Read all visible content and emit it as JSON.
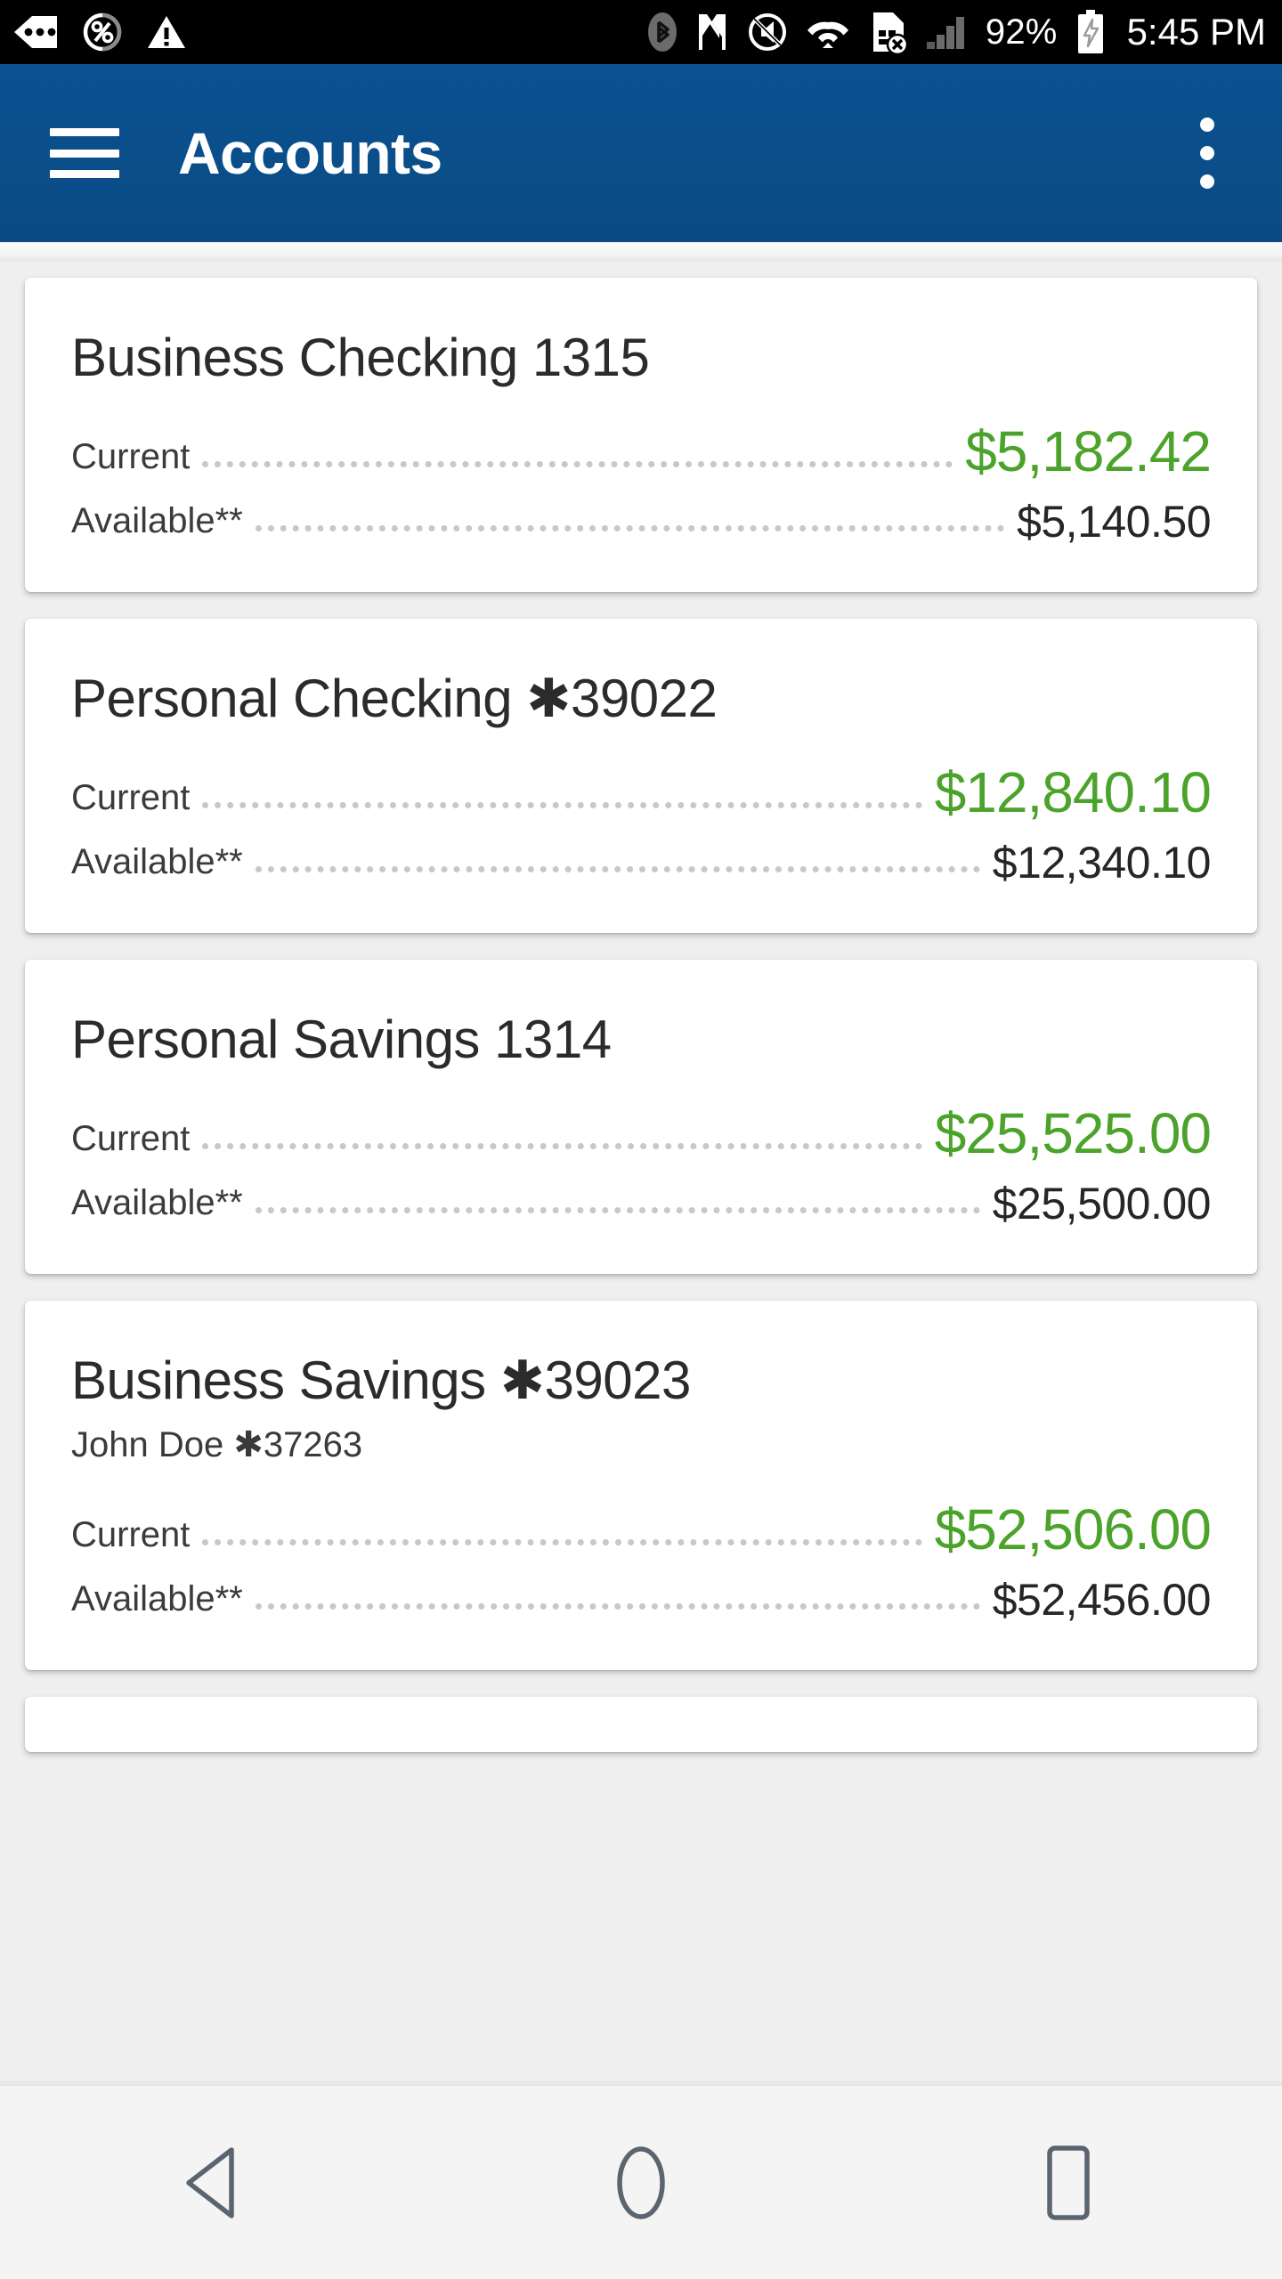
{
  "status_bar": {
    "icons_left": [
      "more-notifications-icon",
      "data-saver-percent-icon",
      "warning-triangle-icon"
    ],
    "icons_right": [
      "bluetooth-icon",
      "nfc-icon",
      "ringer-silent-icon",
      "wifi-icon",
      "sim-card-error-icon",
      "cellular-signal-icon"
    ],
    "battery_percent": "92%",
    "battery_state": "charging-battery-icon",
    "time": "5:45 PM"
  },
  "app_bar": {
    "menu_icon": "hamburger-menu-icon",
    "title": "Accounts",
    "overflow_icon": "overflow-menu-icon",
    "background_color": "#0a5291"
  },
  "theme": {
    "positive_balance_color": "#4ca32b",
    "text_color": "#2b2b2b",
    "page_background": "#efefef"
  },
  "labels": {
    "current": "Current",
    "available": "Available**"
  },
  "accounts": [
    {
      "name": "Business Checking 1315",
      "subtitle": "",
      "current": "$5,182.42",
      "available": "$5,140.50"
    },
    {
      "name": "Personal Checking ✱3​9022",
      "subtitle": "",
      "current": "$12,840.10",
      "available": "$12,340.10"
    },
    {
      "name": "Personal Savings 1314",
      "subtitle": "",
      "current": "$25,525.00",
      "available": "$25,500.00"
    },
    {
      "name": "Business Savings ✱3​9023",
      "subtitle": "John Doe ✱3​7263",
      "current": "$52,506.00",
      "available": "$52,456.00"
    }
  ],
  "nav_bar": {
    "back": "back-button",
    "home": "home-button",
    "recents": "recents-button"
  }
}
